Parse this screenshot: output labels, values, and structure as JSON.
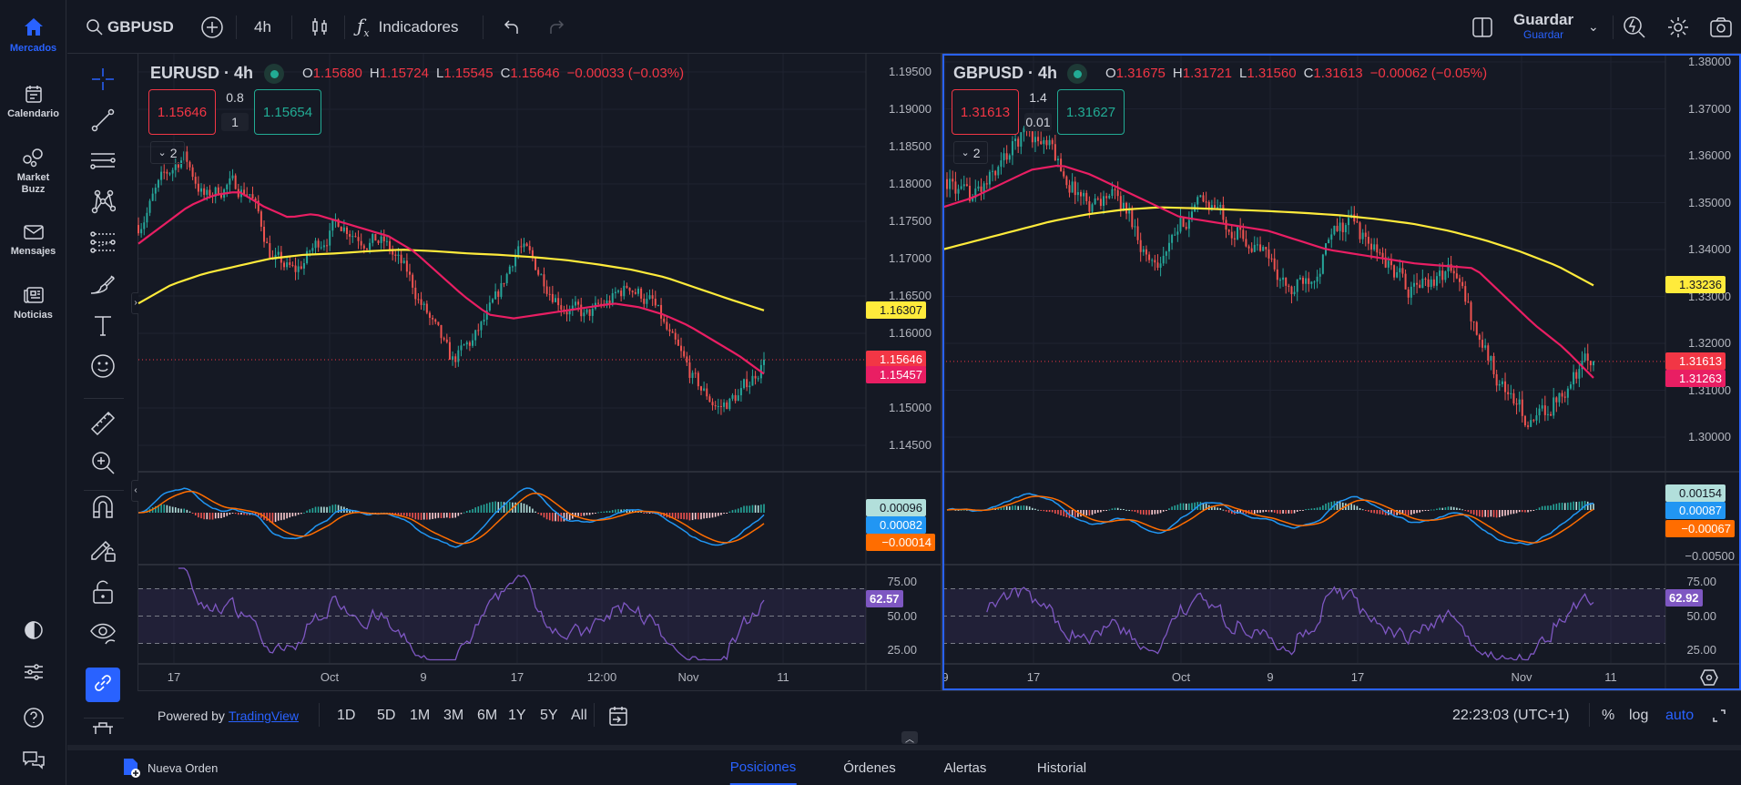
{
  "sidebar": {
    "items": [
      {
        "label": "Mercados",
        "icon": "home-icon",
        "active": true
      },
      {
        "label": "Calendario",
        "icon": "calendar-icon"
      },
      {
        "label": "Market Buzz",
        "icon": "bubbles-icon"
      },
      {
        "label": "Mensajes",
        "icon": "envelope-icon"
      },
      {
        "label": "Noticias",
        "icon": "newspaper-icon"
      }
    ],
    "bottom_icons": [
      "theme-contrast-icon",
      "sliders-icon",
      "help-icon",
      "chat-icon"
    ]
  },
  "toolbar": {
    "symbol": "GBPUSD",
    "interval": "4h",
    "indicators": "Indicadores",
    "save": "Guardar",
    "save_sub": "Guardar"
  },
  "drawing_tools": [
    "crosshair-icon",
    "trend-line-icon",
    "horizontal-lines-icon",
    "pattern-icon",
    "fib-icon",
    "brush-icon",
    "text-icon",
    "emoji-icon",
    "ruler-icon",
    "zoom-in-icon",
    "magnet-icon",
    "pencil-lock-icon",
    "lock-icon",
    "eye-icon",
    "link-icon",
    "trash-icon"
  ],
  "charts": [
    {
      "title": "EURUSD · 4h",
      "ohlc": {
        "o": "1.15680",
        "h": "1.15724",
        "l": "1.15545",
        "c": "1.15646",
        "change": "−0.00033 (−0.03%)"
      },
      "sell": "1.15646",
      "spread_top": "0.8",
      "spread_bottom": "1",
      "buy": "1.15654",
      "collapse_count": "2",
      "price_ticks": [
        "1.19500",
        "1.19000",
        "1.18500",
        "1.18000",
        "1.17500",
        "1.17000",
        "1.16500",
        "1.16000",
        "1.15000",
        "1.14500"
      ],
      "price_tags": {
        "ma_slow": "1.16307",
        "last": "1.15646",
        "ma_fast": "1.15457"
      },
      "macd_tags": {
        "hist": "0.00096",
        "macd": "0.00082",
        "signal": "−0.00014"
      },
      "macd_ticks": [],
      "rsi_ticks": [
        "75.00",
        "50.00",
        "25.00"
      ],
      "rsi_value": "62.57",
      "time_ticks": [
        "17",
        "Oct",
        "9",
        "17",
        "12:00",
        "Nov",
        "11"
      ],
      "close_path": [
        1.1745,
        1.18,
        1.184,
        1.178,
        1.18,
        1.179,
        1.17,
        1.168,
        1.172,
        1.175,
        1.173,
        1.172,
        1.168,
        1.162,
        1.156,
        1.159,
        1.164,
        1.172,
        1.168,
        1.164,
        1.162,
        1.164,
        1.1665,
        1.164,
        1.158,
        1.153,
        1.15,
        1.152,
        1.15646
      ],
      "ma_fast_path": [
        1.172,
        1.1745,
        1.177,
        1.1785,
        1.179,
        1.177,
        1.1755,
        1.176,
        1.175,
        1.174,
        1.173,
        1.171,
        1.168,
        1.165,
        1.1625,
        1.162,
        1.1625,
        1.163,
        1.1635,
        1.164,
        1.1635,
        1.1625,
        1.161,
        1.159,
        1.157,
        1.15457
      ],
      "ma_slow_path": [
        1.164,
        1.1665,
        1.168,
        1.169,
        1.17,
        1.1705,
        1.1707,
        1.171,
        1.1712,
        1.171,
        1.1707,
        1.1705,
        1.1702,
        1.1698,
        1.1692,
        1.1685,
        1.1675,
        1.166,
        1.1645,
        1.16307
      ]
    },
    {
      "title": "GBPUSD · 4h",
      "ohlc": {
        "o": "1.31675",
        "h": "1.31721",
        "l": "1.31560",
        "c": "1.31613",
        "change": "−0.00062 (−0.05%)"
      },
      "sell": "1.31613",
      "spread_top": "1.4",
      "spread_bottom": "0.01",
      "buy": "1.31627",
      "collapse_count": "2",
      "price_ticks": [
        "1.38000",
        "1.37000",
        "1.36000",
        "1.35000",
        "1.34000",
        "1.33000",
        "1.32000",
        "1.31000",
        "1.30000"
      ],
      "price_tags": {
        "ma_slow": "1.33236",
        "last": "1.31613",
        "ma_fast": "1.31263"
      },
      "macd_tags": {
        "hist": "0.00154",
        "macd": "0.00087",
        "signal": "−0.00067"
      },
      "macd_ticks": [
        "−0.00500"
      ],
      "rsi_ticks": [
        "75.00",
        "50.00",
        "25.00"
      ],
      "rsi_value": "62.92",
      "time_ticks": [
        "9",
        "17",
        "Oct",
        "9",
        "17",
        "Nov",
        "11"
      ],
      "close_path": [
        1.355,
        1.35,
        1.354,
        1.36,
        1.366,
        1.362,
        1.355,
        1.35,
        1.352,
        1.348,
        1.338,
        1.34,
        1.348,
        1.35,
        1.346,
        1.342,
        1.338,
        1.33,
        1.335,
        1.342,
        1.346,
        1.34,
        1.336,
        1.331,
        1.334,
        1.336,
        1.325,
        1.315,
        1.308,
        1.302,
        1.308,
        1.314,
        1.31613
      ],
      "ma_fast_path": [
        1.349,
        1.351,
        1.354,
        1.357,
        1.358,
        1.356,
        1.353,
        1.35,
        1.347,
        1.346,
        1.345,
        1.344,
        1.342,
        1.34,
        1.339,
        1.338,
        1.337,
        1.3365,
        1.336,
        1.33,
        1.324,
        1.319,
        1.31263
      ],
      "ma_slow_path": [
        1.34,
        1.342,
        1.344,
        1.346,
        1.3475,
        1.3485,
        1.349,
        1.3488,
        1.3485,
        1.3482,
        1.3478,
        1.3473,
        1.3465,
        1.3455,
        1.344,
        1.342,
        1.3395,
        1.3365,
        1.33236
      ]
    }
  ],
  "colors": {
    "up": "#26a69a",
    "down": "#ef5350",
    "ma_fast": "#e91e63",
    "ma_slow": "#ffeb3b",
    "macd": "#2196f3",
    "signal": "#ff6d00",
    "rsi": "#7e57c2",
    "accent": "#2962ff"
  },
  "bottom": {
    "powered_by": "Powered by",
    "tradingview": "TradingView",
    "ranges": [
      "1D",
      "5D",
      "1M",
      "3M",
      "6M",
      "1Y",
      "5Y",
      "All"
    ],
    "clock": "22:23:03 (UTC+1)",
    "percent": "%",
    "log": "log",
    "auto": "auto"
  },
  "tabs": {
    "new_order": "Nueva Orden",
    "items": [
      "Posiciones",
      "Órdenes",
      "Alertas",
      "Historial"
    ],
    "active": 0
  }
}
